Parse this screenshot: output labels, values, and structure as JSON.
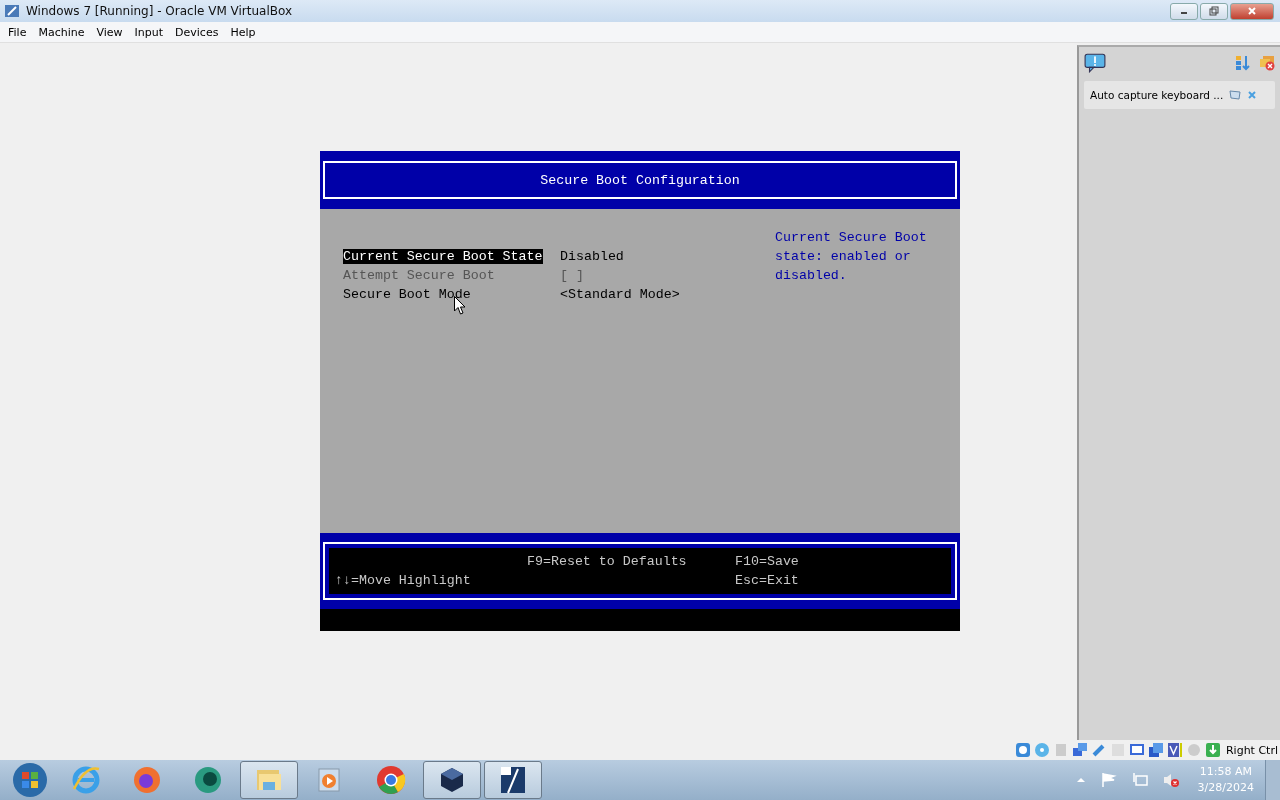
{
  "window": {
    "title": "Windows 7 [Running] - Oracle VM VirtualBox"
  },
  "menu": [
    "File",
    "Machine",
    "View",
    "Input",
    "Devices",
    "Help"
  ],
  "bios": {
    "title": "Secure Boot Configuration",
    "items": [
      {
        "label": "Current Secure Boot State",
        "value": "Disabled",
        "selected": true,
        "disabled": false
      },
      {
        "label": "Attempt Secure Boot",
        "value": "[ ]",
        "selected": false,
        "disabled": true
      },
      {
        "label": "Secure Boot Mode",
        "value": "<Standard Mode>",
        "selected": false,
        "disabled": false
      }
    ],
    "help": "Current Secure Boot state: enabled or disabled.",
    "footer": {
      "left": [
        "↑↓=Move Highlight"
      ],
      "middle": [
        "F9=Reset to Defaults"
      ],
      "right": [
        "F10=Save",
        "Esc=Exit"
      ]
    }
  },
  "side_panel": {
    "notification": "Auto capture keyboard ..."
  },
  "status_bar": {
    "host_key": "Right Ctrl"
  },
  "taskbar": {
    "apps": [
      {
        "kind": "start",
        "active": false
      },
      {
        "kind": "ie",
        "active": false
      },
      {
        "kind": "firefox",
        "active": false
      },
      {
        "kind": "green",
        "active": false
      },
      {
        "kind": "explorer",
        "active": true
      },
      {
        "kind": "media",
        "active": false
      },
      {
        "kind": "chrome",
        "active": false
      },
      {
        "kind": "virtualbox",
        "active": true
      },
      {
        "kind": "win7",
        "active": true
      }
    ],
    "time": "11:58 AM",
    "date": "3/28/2024"
  }
}
